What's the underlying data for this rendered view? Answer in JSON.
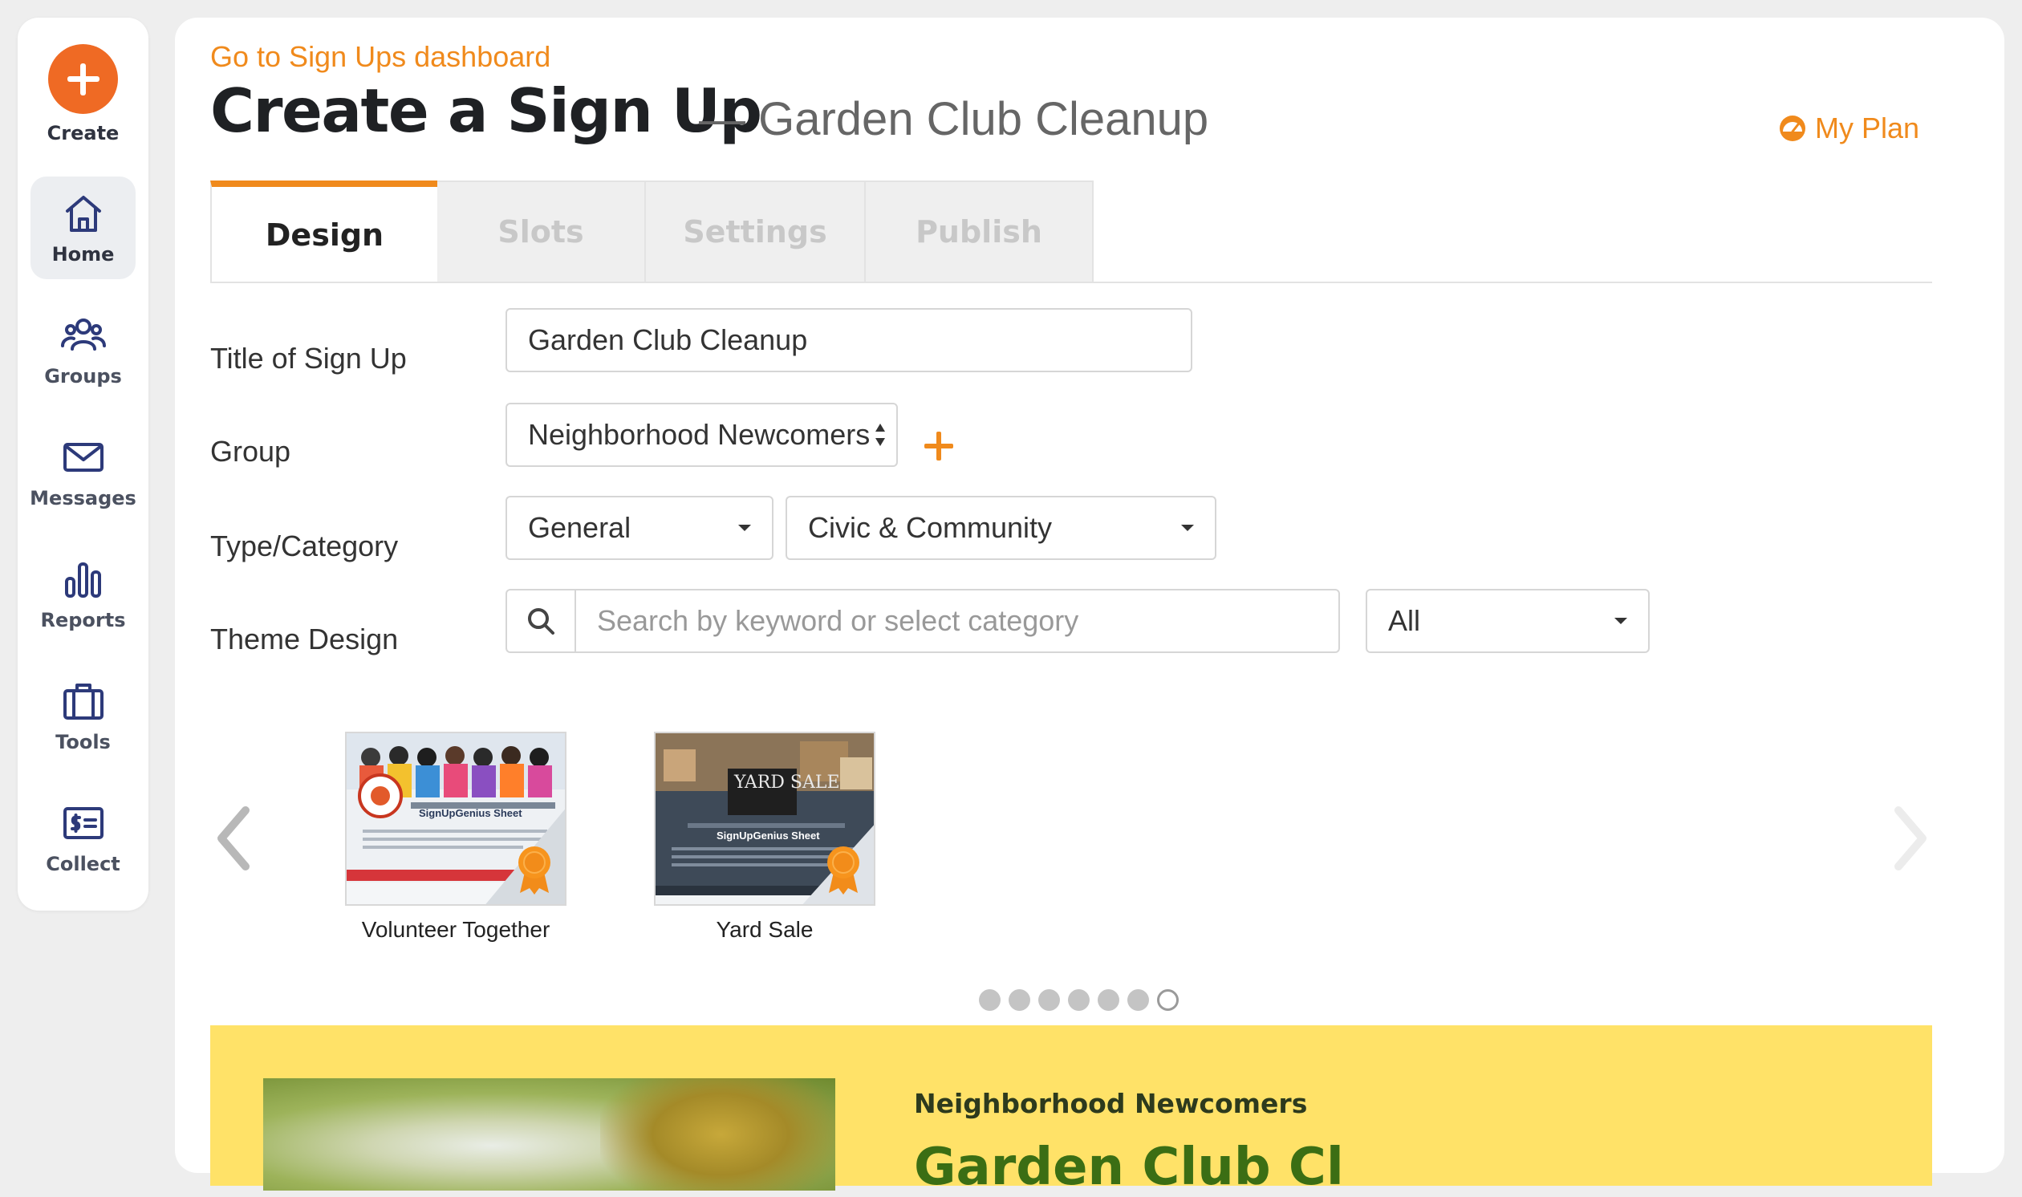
{
  "sidebar": {
    "create_label": "Create",
    "items": [
      {
        "label": "Home",
        "icon": "home-icon"
      },
      {
        "label": "Groups",
        "icon": "groups-icon"
      },
      {
        "label": "Messages",
        "icon": "envelope-icon"
      },
      {
        "label": "Reports",
        "icon": "bar-chart-icon"
      },
      {
        "label": "Tools",
        "icon": "briefcase-icon"
      },
      {
        "label": "Collect",
        "icon": "dollar-card-icon"
      }
    ]
  },
  "header": {
    "back_link": "Go to Sign Ups dashboard",
    "title": "Create a Sign Up",
    "subtitle": "— Garden Club Cleanup",
    "my_plan": "My Plan"
  },
  "tabs": [
    {
      "label": "Design",
      "active": true
    },
    {
      "label": "Slots",
      "active": false
    },
    {
      "label": "Settings",
      "active": false
    },
    {
      "label": "Publish",
      "active": false
    }
  ],
  "form": {
    "title_label": "Title of Sign Up",
    "title_value": "Garden Club Cleanup",
    "group_label": "Group",
    "group_value": "Neighborhood Newcomers",
    "type_label": "Type/Category",
    "type_value": "General",
    "category_value": "Civic & Community",
    "theme_label": "Theme Design",
    "theme_search_placeholder": "Search by keyword or select category",
    "theme_filter_value": "All"
  },
  "themes": [
    {
      "name": "Volunteer Together",
      "thumb_sheet_title": "SignUpGenius Sheet"
    },
    {
      "name": "Yard Sale",
      "thumb_sheet_title": "SignUpGenius Sheet",
      "thumb_banner": "YARD SALE"
    }
  ],
  "carousel": {
    "page_count": 7,
    "current_page": 7
  },
  "preview": {
    "group_name": "Neighborhood Newcomers",
    "title": "Garden Club Cl"
  },
  "colors": {
    "accent": "#f08a1c",
    "create_button": "#ef6a24",
    "preview_background": "#ffe268",
    "preview_title": "#3b6e14"
  }
}
